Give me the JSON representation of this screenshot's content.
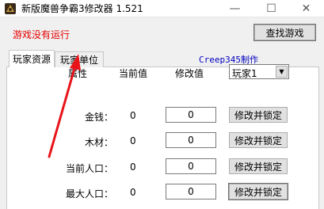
{
  "window": {
    "title": "新版魔兽争霸3修改器 1.521",
    "controls": {
      "minimize": "—",
      "maximize": "☐",
      "close": "✕"
    }
  },
  "status_text": "游戏没有运行",
  "find_game_label": "查找游戏",
  "tabs": [
    {
      "label": "玩家资源",
      "selected": true
    },
    {
      "label": "玩家单位",
      "selected": false
    }
  ],
  "credit": "Creep345制作",
  "headers": {
    "attribute": "属性",
    "current": "当前值",
    "modify": "修改值"
  },
  "player_select": {
    "value": "玩家1"
  },
  "rows": [
    {
      "label": "金钱：",
      "current": "0",
      "modify": "0",
      "button": "修改并锁定"
    },
    {
      "label": "木材：",
      "current": "0",
      "modify": "0",
      "button": "修改并锁定"
    },
    {
      "label": "当前人口：",
      "current": "0",
      "modify": "0",
      "button": "修改并锁定"
    },
    {
      "label": "最大人口：",
      "current": "0",
      "modify": "0",
      "button": "修改并锁定"
    }
  ],
  "colors": {
    "status": "#e60000",
    "credit": "#0000c0",
    "annotation_arrow": "#e8141a"
  }
}
